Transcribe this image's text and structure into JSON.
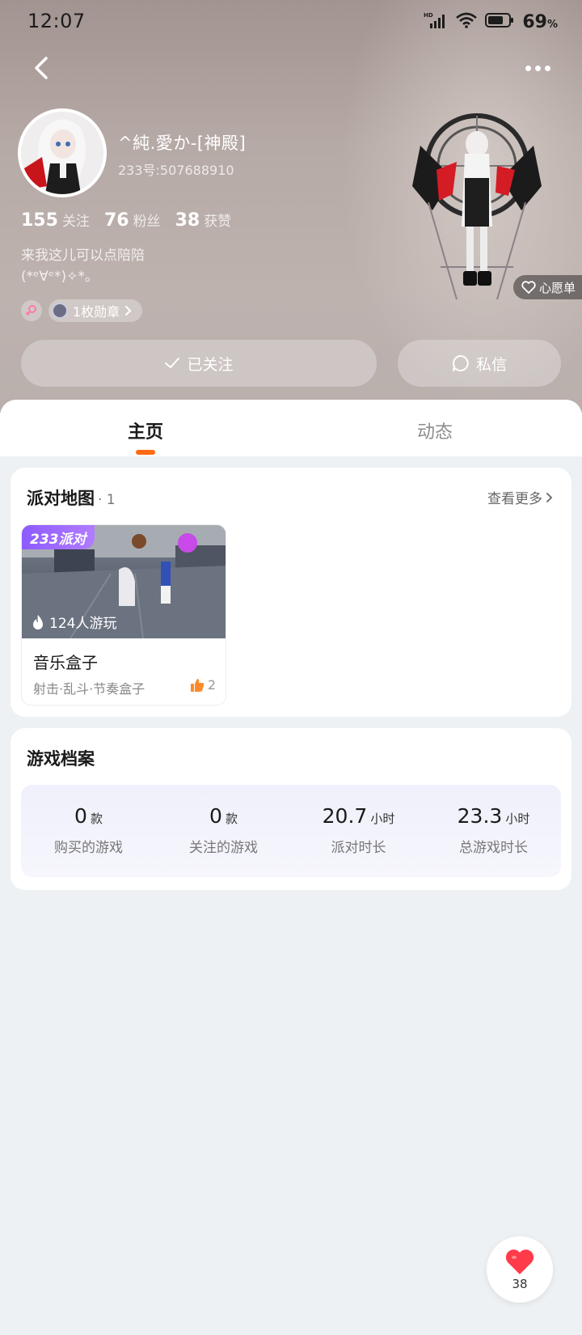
{
  "status_bar": {
    "time": "12:07",
    "battery": "69",
    "battery_unit": "%",
    "network": "HD"
  },
  "profile": {
    "nickname": "^純.愛か-[神殿]",
    "user_id": "233号:507688910",
    "stats": [
      {
        "value": "155",
        "label": "关注"
      },
      {
        "value": "76",
        "label": "粉丝"
      },
      {
        "value": "38",
        "label": "获赞"
      }
    ],
    "bio_line1": "来我这儿可以点陪陪",
    "bio_line2": "(*ᵉ∀ᵉ*)✧*。",
    "medals": "1枚勋章",
    "follow_label": "已关注",
    "dm_label": "私信",
    "wish_label": "心愿单"
  },
  "tabs": {
    "home": "主页",
    "feed": "动态"
  },
  "party_map": {
    "title": "派对地图",
    "count": "· 1",
    "see_more": "查看更多",
    "item": {
      "badge": "233派对",
      "players": "124人游玩",
      "name": "音乐盒子",
      "tags": "射击·乱斗·节奏盒子",
      "likes": "2"
    }
  },
  "game_archive": {
    "title": "游戏档案",
    "items": [
      {
        "value": "0",
        "unit": "款",
        "label": "购买的游戏"
      },
      {
        "value": "0",
        "unit": "款",
        "label": "关注的游戏"
      },
      {
        "value": "20.7",
        "unit": "小时",
        "label": "派对时长"
      },
      {
        "value": "23.3",
        "unit": "小时",
        "label": "总游戏时长"
      }
    ]
  },
  "like_fab": {
    "count": "38"
  },
  "colors": {
    "accent": "#ff6a13",
    "party_purple": "#8d5bff",
    "heart": "#ff3b4a"
  }
}
